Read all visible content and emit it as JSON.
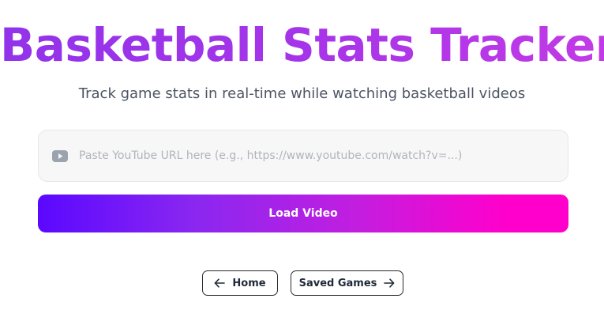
{
  "header": {
    "title": "Basketball Stats Tracker",
    "subtitle": "Track game stats in real-time while watching basketball videos"
  },
  "url_input": {
    "icon": "youtube-icon",
    "value": "",
    "placeholder": "Paste YouTube URL here (e.g., https://www.youtube.com/watch?v=...)"
  },
  "load_button": {
    "label": "Load Video"
  },
  "nav": {
    "home_label": "Home",
    "home_icon": "arrow-left-icon",
    "saved_label": "Saved Games",
    "saved_icon": "arrow-right-icon"
  },
  "colors": {
    "title_gradient_start": "#9233ea",
    "title_gradient_end": "#c23ae6",
    "button_gradient_start": "#5a08ff",
    "button_gradient_end": "#ff00cc",
    "subtitle": "#4b5563",
    "input_background": "#f7f7f8"
  }
}
